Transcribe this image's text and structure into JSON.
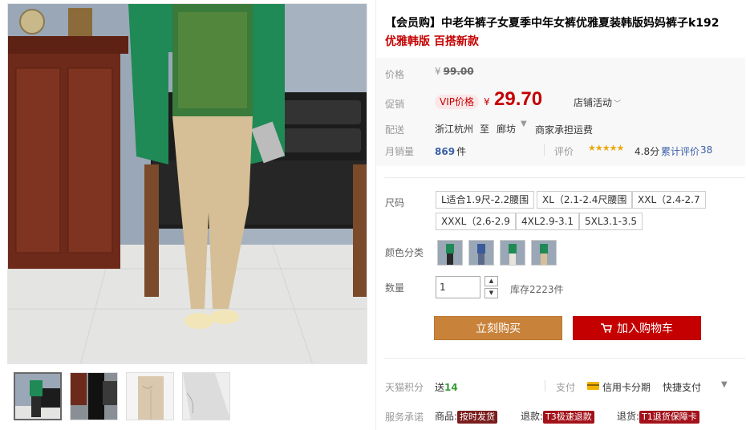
{
  "product": {
    "title": "【会员购】中老年裤子女夏季中年女裤优雅夏装韩版妈妈裤子k192",
    "subtitle": "优雅韩版 百搭新款"
  },
  "price": {
    "label": "价格",
    "currency": "¥",
    "original": "99.00"
  },
  "promo": {
    "label": "促销",
    "badge": "VIP价格",
    "currency": "¥",
    "price": "29.70",
    "shop_activity": "店铺活动"
  },
  "shipping": {
    "label": "配送",
    "from": "浙江杭州",
    "to_label": "至",
    "to": "廊坊",
    "caret": "▼",
    "fee": "商家承担运费"
  },
  "sales": {
    "label": "月销量",
    "count": "869",
    "unit": "件",
    "rating_label": "评价",
    "stars": "★★★★★",
    "score": "4.8分",
    "reviews_label": "累计评价",
    "reviews_count": "38"
  },
  "size": {
    "label": "尺码",
    "options": [
      "L适合1.9尺-2.2腰围",
      "XL（2.1-2.4尺腰围",
      "XXL（2.4-2.7",
      "XXXL（2.6-2.9",
      "4XL2.9-3.1",
      "5XL3.1-3.5"
    ]
  },
  "color": {
    "label": "颜色分类"
  },
  "quantity": {
    "label": "数量",
    "value": "1",
    "stock": "库存2223件"
  },
  "actions": {
    "buy_now": "立刻购买",
    "add_cart": "加入购物车"
  },
  "points": {
    "label": "天猫积分",
    "text": "送",
    "value": "14"
  },
  "payment": {
    "label": "支付",
    "card": "信用卡分期",
    "quick": "快捷支付",
    "caret": "▼"
  },
  "service": {
    "label": "服务承诺",
    "goods_label": "商品:",
    "goods_tag": "按时发货",
    "refund_label": "退款:",
    "refund_tag": "T3极速退款",
    "return_label": "退货:",
    "return_tag": "T1退货保障卡"
  },
  "colors": {
    "accent": "#c40000",
    "buy_now": "#c9823a",
    "link": "#3a5fa8"
  }
}
